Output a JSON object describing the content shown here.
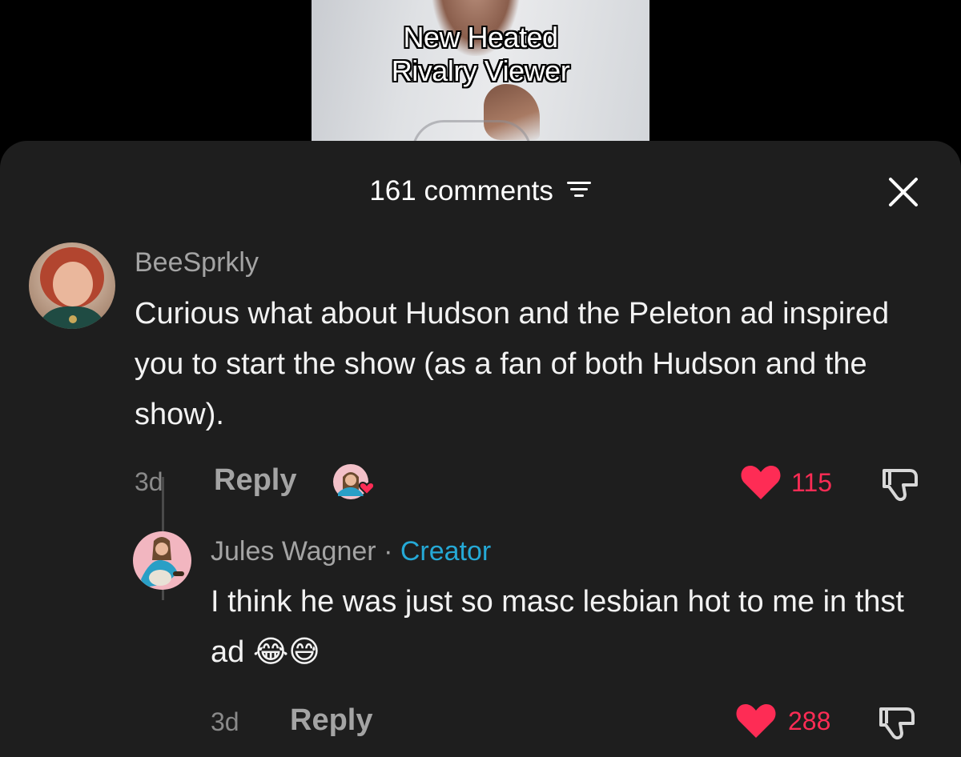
{
  "video": {
    "caption_line1": "New Heated",
    "caption_line2": "Rivalry Viewer"
  },
  "sheet": {
    "comment_count_label": "161 comments"
  },
  "comments": [
    {
      "username": "BeeSprkly",
      "text": "Curious what about Hudson and the Peleton ad inspired you to start the show (as a fan of both Hudson and the show).",
      "time": "3d",
      "reply_label": "Reply",
      "likes": "115",
      "creator_liked": true
    },
    {
      "username": "Jules Wagner",
      "separator": "·",
      "badge": "Creator",
      "text": "I think he was just so masc lesbian hot to me in thst ad 😂😅",
      "time": "3d",
      "reply_label": "Reply",
      "likes": "288"
    }
  ],
  "colors": {
    "background": "#000000",
    "sheet": "#1e1e1e",
    "like": "#fe2c55",
    "creator_badge": "#25a9d6",
    "muted_text": "#a4a4a4"
  },
  "icons": [
    "filter-icon",
    "close-icon",
    "heart-icon",
    "dislike-icon"
  ]
}
